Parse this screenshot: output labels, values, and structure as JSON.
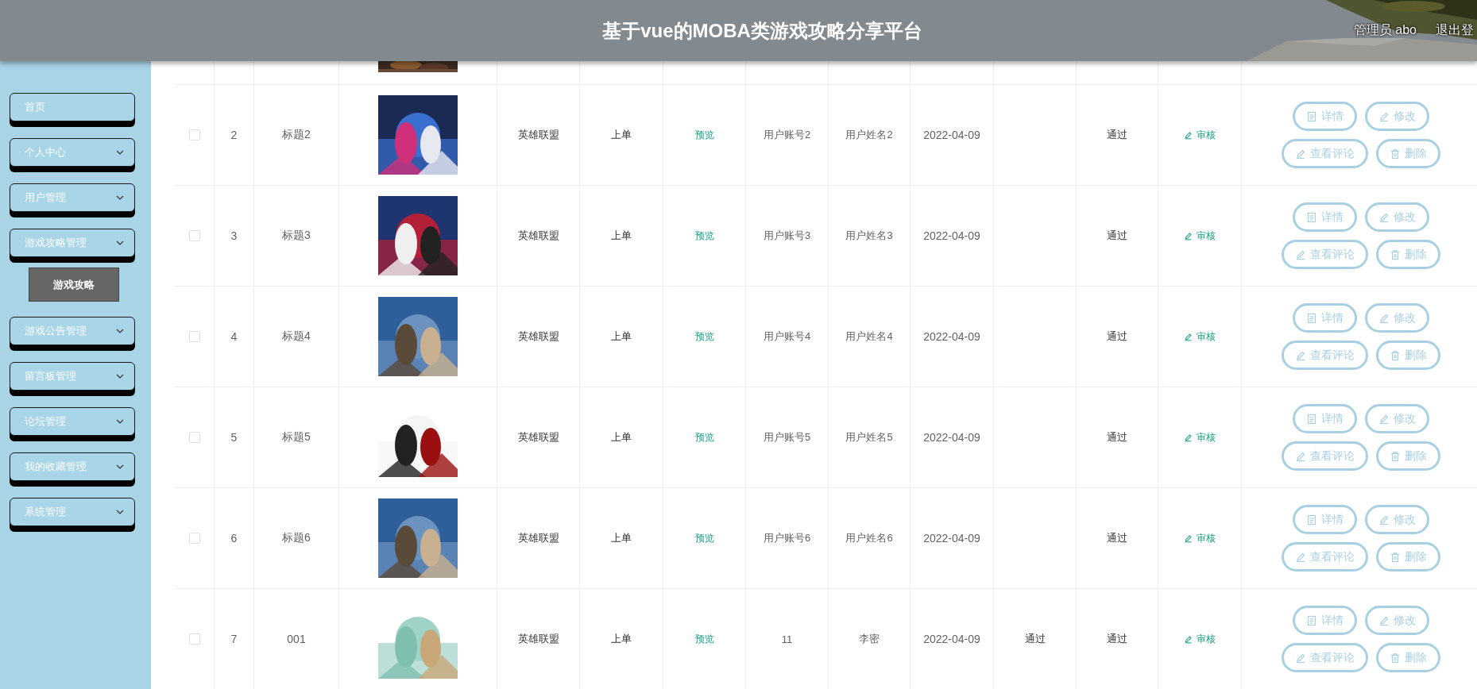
{
  "header": {
    "title": "基于vue的MOBA类游戏攻略分享平台",
    "user": "管理员 abo",
    "logout": "退出登"
  },
  "sidebar": {
    "items": [
      {
        "label": "首页",
        "kind": "link"
      },
      {
        "label": "个人中心",
        "kind": "menu"
      },
      {
        "label": "用户管理",
        "kind": "menu"
      },
      {
        "label": "游戏攻略管理",
        "kind": "menu",
        "children": [
          {
            "label": "游戏攻略",
            "selected": true
          }
        ]
      },
      {
        "label": "游戏公告管理",
        "kind": "menu"
      },
      {
        "label": "留言板管理",
        "kind": "menu"
      },
      {
        "label": "论坛管理",
        "kind": "menu"
      },
      {
        "label": "我的收藏管理",
        "kind": "menu"
      },
      {
        "label": "系统管理",
        "kind": "menu"
      }
    ]
  },
  "table": {
    "rows": [
      {
        "checked": false,
        "index": "2",
        "title": "标题2",
        "category": "英雄联盟",
        "position": "上单",
        "preview": "预览",
        "account": "用户账号2",
        "name": "用户姓名2",
        "date": "2022-04-09",
        "status": "通过",
        "review": "审核",
        "actions": [
          {
            "kind": "detail",
            "label": "详情"
          },
          {
            "kind": "edit",
            "label": "修改"
          },
          {
            "kind": "comments",
            "label": "查看评论"
          },
          {
            "kind": "delete",
            "label": "删除"
          }
        ]
      },
      {
        "checked": false,
        "index": "3",
        "title": "标题3",
        "category": "英雄联盟",
        "position": "上单",
        "preview": "预览",
        "account": "用户账号3",
        "name": "用户姓名3",
        "date": "2022-04-09",
        "status": "通过",
        "review": "审核",
        "actions": [
          {
            "kind": "detail",
            "label": "详情"
          },
          {
            "kind": "edit",
            "label": "修改"
          },
          {
            "kind": "comments",
            "label": "查看评论"
          },
          {
            "kind": "delete",
            "label": "删除"
          }
        ]
      },
      {
        "checked": false,
        "index": "4",
        "title": "标题4",
        "category": "英雄联盟",
        "position": "上单",
        "preview": "预览",
        "account": "用户账号4",
        "name": "用户姓名4",
        "date": "2022-04-09",
        "status": "通过",
        "review": "审核",
        "actions": [
          {
            "kind": "detail",
            "label": "详情"
          },
          {
            "kind": "edit",
            "label": "修改"
          },
          {
            "kind": "comments",
            "label": "查看评论"
          },
          {
            "kind": "delete",
            "label": "删除"
          }
        ]
      },
      {
        "checked": false,
        "index": "5",
        "title": "标题5",
        "category": "英雄联盟",
        "position": "上单",
        "preview": "预览",
        "account": "用户账号5",
        "name": "用户姓名5",
        "date": "2022-04-09",
        "status": "通过",
        "review": "审核",
        "actions": [
          {
            "kind": "detail",
            "label": "详情"
          },
          {
            "kind": "edit",
            "label": "修改"
          },
          {
            "kind": "comments",
            "label": "查看评论"
          },
          {
            "kind": "delete",
            "label": "删除"
          }
        ]
      },
      {
        "checked": false,
        "index": "6",
        "title": "标题6",
        "category": "英雄联盟",
        "position": "上单",
        "preview": "预览",
        "account": "用户账号6",
        "name": "用户姓名6",
        "date": "2022-04-09",
        "status": "通过",
        "review": "审核",
        "actions": [
          {
            "kind": "detail",
            "label": "详情"
          },
          {
            "kind": "edit",
            "label": "修改"
          },
          {
            "kind": "comments",
            "label": "查看评论"
          },
          {
            "kind": "delete",
            "label": "删除"
          }
        ]
      },
      {
        "checked": false,
        "index": "7",
        "title": "001",
        "category": "英雄联盟",
        "position": "上单",
        "preview": "预览",
        "account": "11",
        "name": "李密",
        "date": "2022-04-09",
        "column_10": "通过",
        "status": "通过",
        "review": "审核",
        "actions": [
          {
            "kind": "detail",
            "label": "详情"
          },
          {
            "kind": "edit",
            "label": "修改"
          },
          {
            "kind": "comments",
            "label": "查看评论"
          },
          {
            "kind": "delete",
            "label": "删除"
          }
        ]
      }
    ]
  }
}
